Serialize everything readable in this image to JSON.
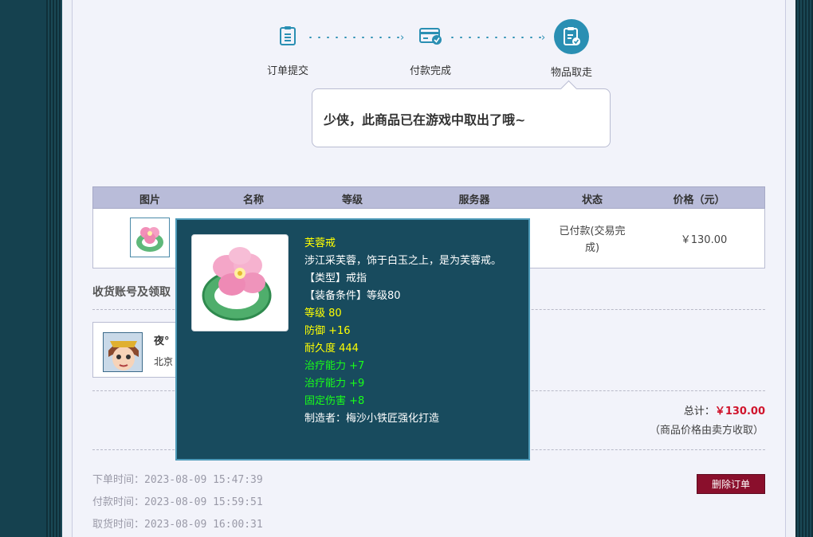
{
  "steps": [
    {
      "label": "订单提交",
      "icon": "clipboard-list-icon"
    },
    {
      "label": "付款完成",
      "icon": "credit-card-check-icon"
    },
    {
      "label": "物品取走",
      "icon": "clipboard-check-icon"
    }
  ],
  "bubble_text": "少侠，此商品已在游戏中取出了哦~",
  "table": {
    "headers": [
      "图片",
      "名称",
      "等级",
      "服务器",
      "状态",
      "价格（元）"
    ],
    "row": {
      "status_line1": "已付款(交易完",
      "status_line2": "成)",
      "price": "￥130.00"
    }
  },
  "receiver_section": {
    "title": "收货账号及领取",
    "name": "夜°",
    "server": "北京"
  },
  "total": {
    "label": "总计：",
    "amount": "￥130.00",
    "note": "（商品价格由卖方收取）"
  },
  "times": {
    "order": "下单时间：2023-08-09 15:47:39",
    "pay": "付款时间：2023-08-09 15:59:51",
    "take": "取货时间：2023-08-09 16:00:31"
  },
  "delete_button": "删除订单",
  "tooltip": {
    "name": "芙蓉戒",
    "desc": "涉江采芙蓉，饰于白玉之上，是为芙蓉戒。",
    "type": "【类型】戒指",
    "requirement": "【装备条件】等级80",
    "level": "等级 80",
    "defense": "防御 +16",
    "durability": "耐久度 444",
    "heal1": "治疗能力 +7",
    "heal2": "治疗能力 +9",
    "fixed_dmg": "固定伤害 +8",
    "maker": "制造者：梅沙小铁匠强化打造"
  },
  "colors": {
    "accent": "#2a8fb3",
    "tooltip_bg": "#184b5e",
    "header_bg": "#b9bcd9",
    "delete_btn": "#8a0f2c",
    "total_red": "#d0142c"
  }
}
